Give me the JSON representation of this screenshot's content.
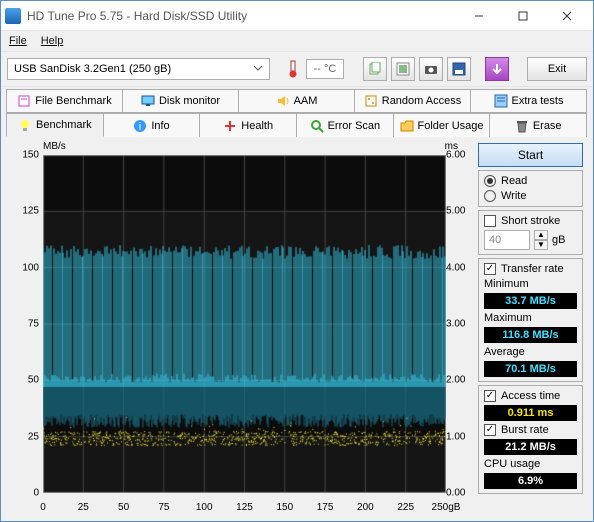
{
  "window": {
    "title": "HD Tune Pro 5.75 - Hard Disk/SSD Utility"
  },
  "menubar": {
    "file": "File",
    "help": "Help"
  },
  "toolbar": {
    "drive": "USB SanDisk 3.2Gen1 (250 gB)",
    "temp": "-- °C",
    "exit": "Exit"
  },
  "tabs": {
    "row1": [
      {
        "label": "File Benchmark",
        "icon": "file-bench"
      },
      {
        "label": "Disk monitor",
        "icon": "monitor"
      },
      {
        "label": "AAM",
        "icon": "speaker"
      },
      {
        "label": "Random Access",
        "icon": "dice"
      },
      {
        "label": "Extra tests",
        "icon": "wrench"
      }
    ],
    "row2": [
      {
        "label": "Benchmark",
        "icon": "bulb",
        "active": true
      },
      {
        "label": "Info",
        "icon": "info"
      },
      {
        "label": "Health",
        "icon": "health"
      },
      {
        "label": "Error Scan",
        "icon": "scan"
      },
      {
        "label": "Folder Usage",
        "icon": "folder"
      },
      {
        "label": "Erase",
        "icon": "trash"
      }
    ]
  },
  "side": {
    "start": "Start",
    "mode": {
      "read": "Read",
      "write": "Write"
    },
    "short_stroke": {
      "label": "Short stroke",
      "value": "40",
      "unit": "gB"
    },
    "transfer_rate": {
      "label": "Transfer rate",
      "min_label": "Minimum",
      "min": "33.7 MB/s",
      "max_label": "Maximum",
      "max": "116.8 MB/s",
      "avg_label": "Average",
      "avg": "70.1 MB/s"
    },
    "access": {
      "label": "Access time",
      "value": "0.911 ms"
    },
    "burst": {
      "label": "Burst rate",
      "value": "21.2 MB/s"
    },
    "cpu": {
      "label": "CPU usage",
      "value": "6.9%"
    }
  },
  "chart_data": {
    "type": "line",
    "title": "",
    "xlabel": "",
    "ylabel_left": "MB/s",
    "ylabel_right": "ms",
    "x_categories": [
      "0",
      "25",
      "50",
      "75",
      "100",
      "125",
      "150",
      "175",
      "200",
      "225",
      "250gB"
    ],
    "y_ticks_left": [
      0,
      25,
      50,
      75,
      100,
      125,
      150
    ],
    "y_ticks_right": [
      0.0,
      1.0,
      2.0,
      3.0,
      4.0,
      5.0,
      6.0
    ],
    "xlim": [
      0,
      250
    ],
    "ylim_left": [
      0,
      150
    ],
    "ylim_right": [
      0,
      6
    ],
    "transfer_band_left": {
      "low": 49,
      "high": 110,
      "avg": 70.1
    },
    "access_band_right": {
      "low": 0.85,
      "high": 1.1,
      "avg": 0.911
    },
    "series": [
      {
        "name": "Transfer rate (MB/s, left axis)",
        "values_summary": "dense spikes oscillating between ~49 and ~110 MB/s across full range"
      },
      {
        "name": "Access time (ms, right axis)",
        "values_summary": "scattered points around 0.85–1.1 ms across full range"
      }
    ]
  }
}
